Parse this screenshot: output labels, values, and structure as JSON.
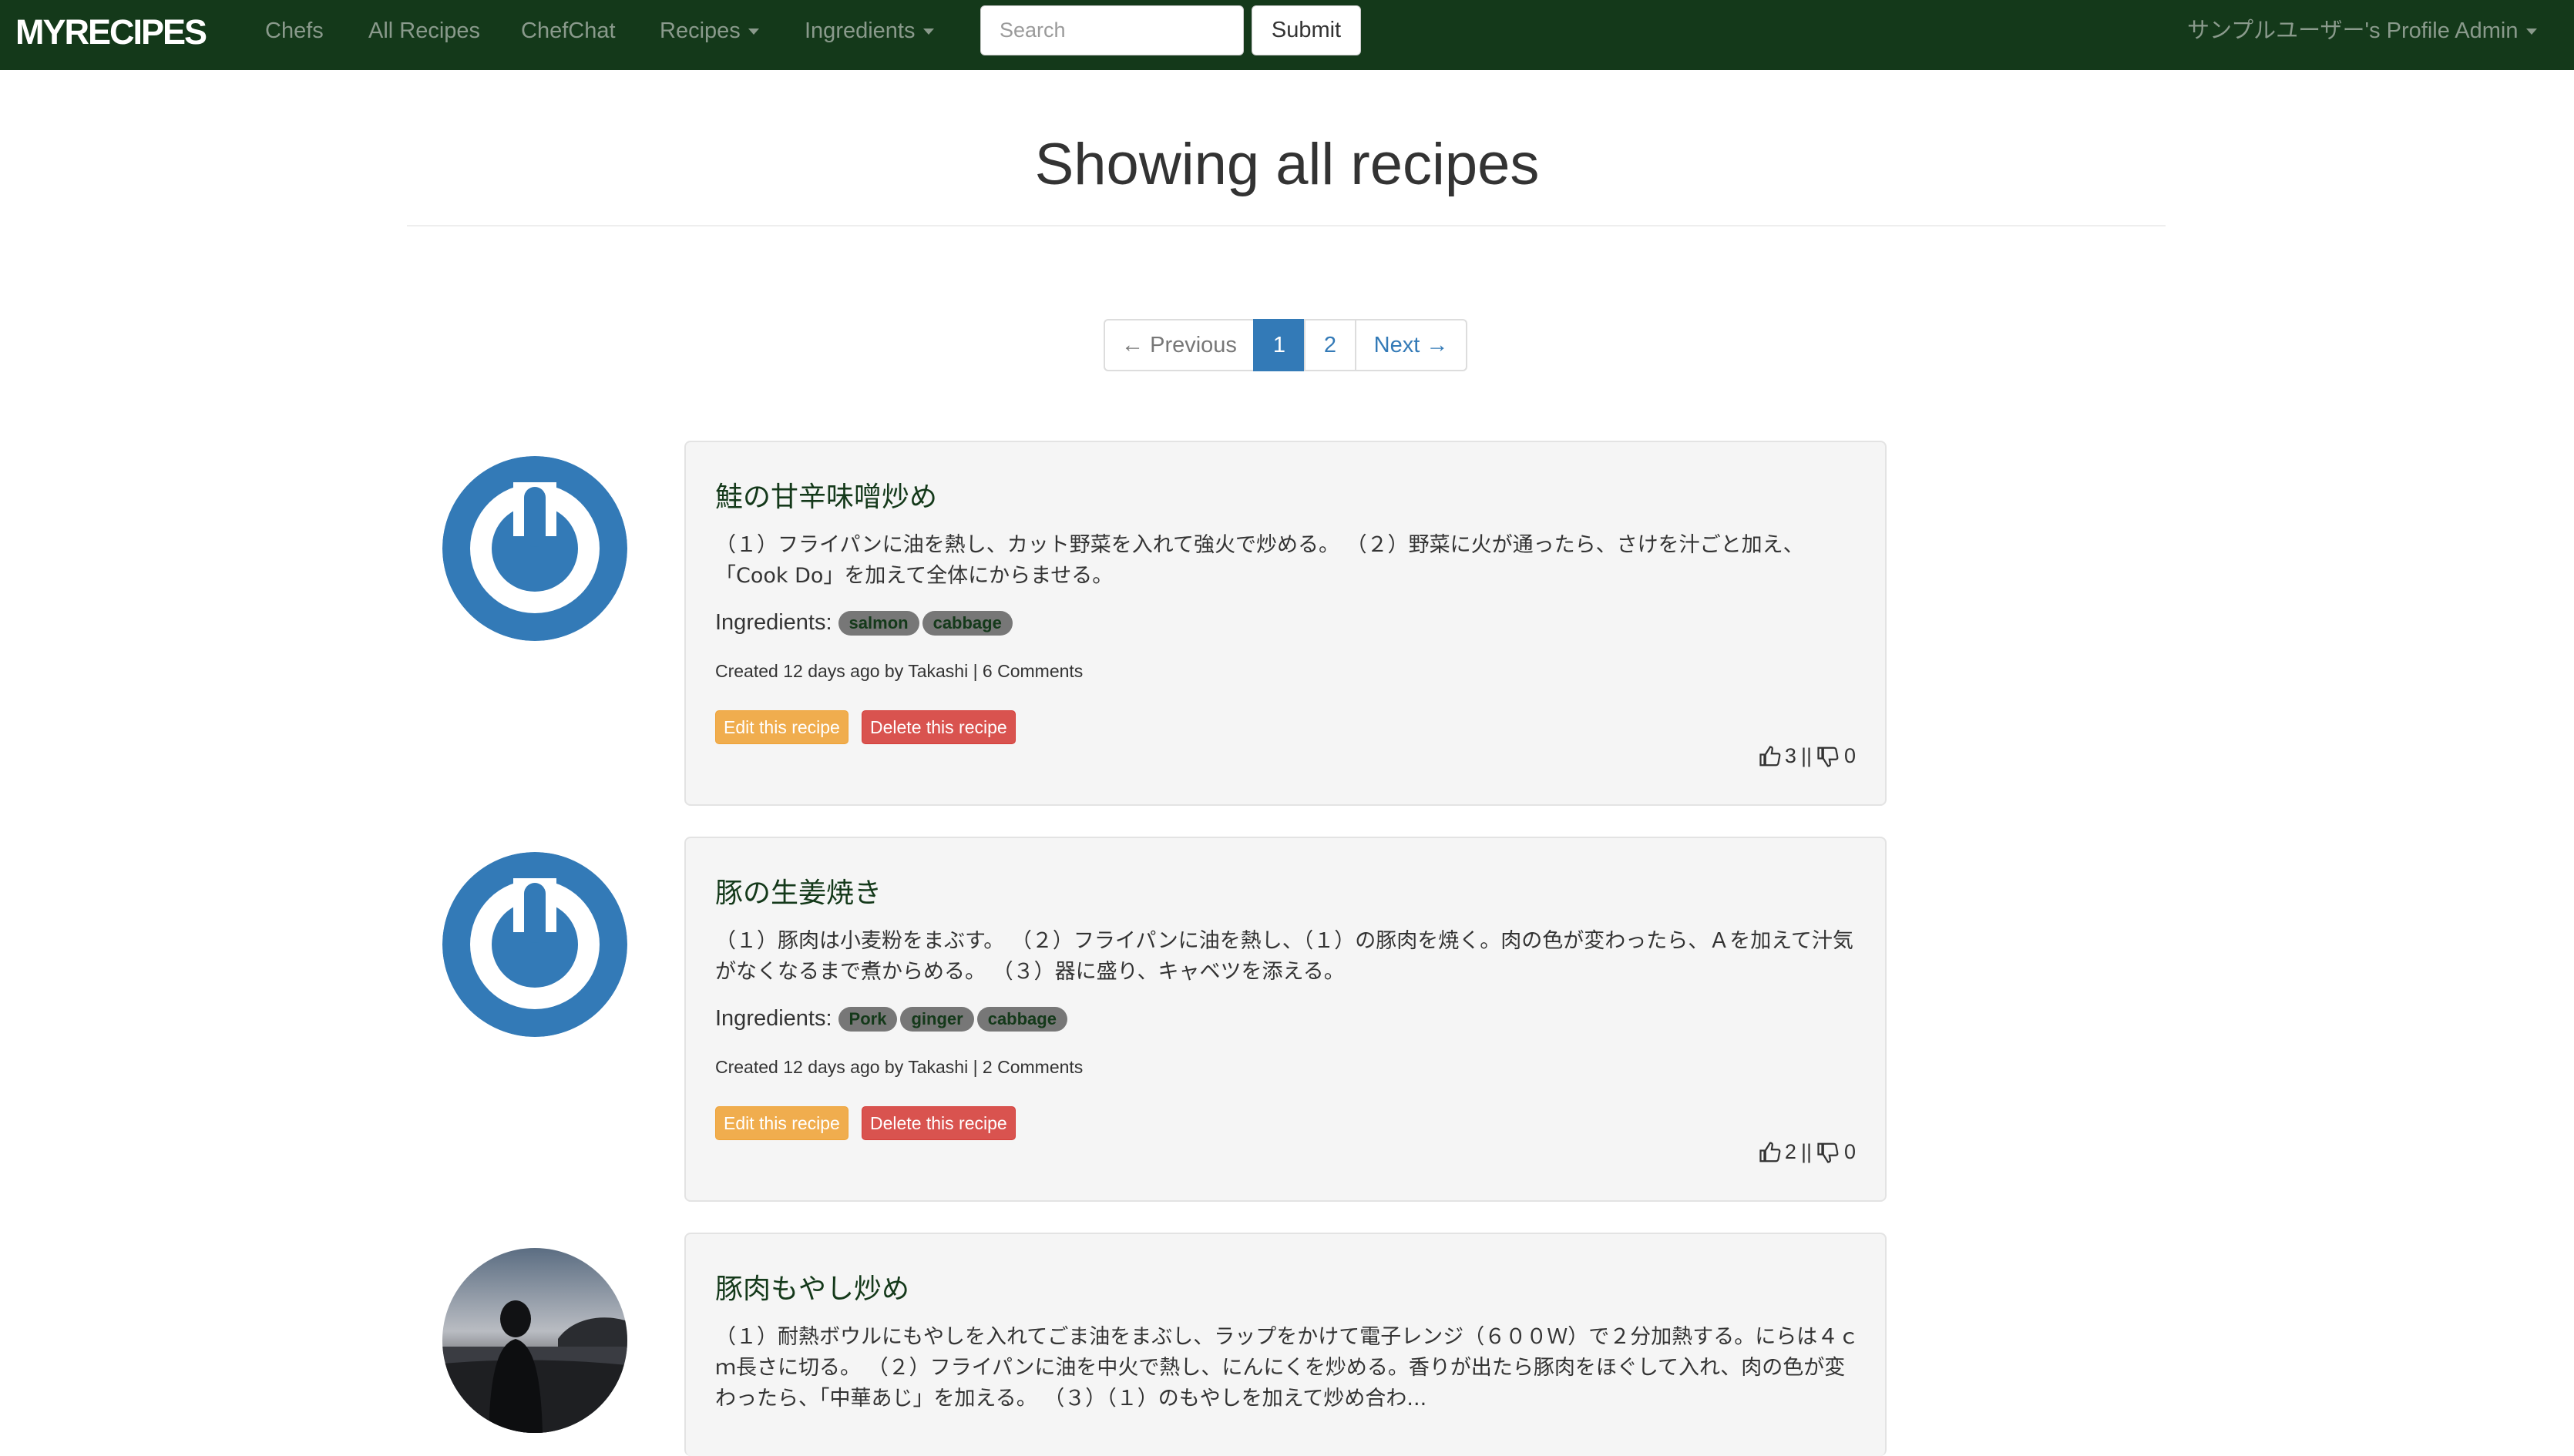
{
  "nav": {
    "brand": "MYRECIPES",
    "links": [
      "Chefs",
      "All Recipes",
      "ChefChat",
      "Recipes",
      "Ingredients"
    ],
    "search_placeholder": "Search",
    "submit_label": "Submit",
    "profile_label": "サンプルユーザー's Profile Admin"
  },
  "page": {
    "title": "Showing all recipes"
  },
  "pagination": {
    "previous": "← Previous",
    "pages": [
      "1",
      "2"
    ],
    "current": "1",
    "next": "Next →"
  },
  "recipes": [
    {
      "title": "鮭の甘辛味噌炒め",
      "description": "（１）フライパンに油を熱し、カット野菜を入れて強火で炒める。 （２）野菜に火が通ったら、さけを汁ごと加え、「Cook Do」を加えて全体にからませる。",
      "ingredients_label": "Ingredients:",
      "ingredients": [
        "salmon",
        "cabbage"
      ],
      "meta": "Created 12 days ago by Takashi | 6 Comments",
      "edit_label": "Edit this recipe",
      "delete_label": "Delete this recipe",
      "likes": "3",
      "separator": "||",
      "dislikes": "0",
      "avatar": "power-icon-avatar"
    },
    {
      "title": "豚の生姜焼き",
      "description": "（１）豚肉は小麦粉をまぶす。 （２）フライパンに油を熱し、（１）の豚肉を焼く。肉の色が変わったら、Ａを加えて汁気がなくなるまで煮からめる。 （３）器に盛り、キャベツを添える。",
      "ingredients_label": "Ingredients:",
      "ingredients": [
        "Pork",
        "ginger",
        "cabbage"
      ],
      "meta": "Created 12 days ago by Takashi | 2 Comments",
      "edit_label": "Edit this recipe",
      "delete_label": "Delete this recipe",
      "likes": "2",
      "separator": "||",
      "dislikes": "0",
      "avatar": "power-icon-avatar"
    },
    {
      "title": "豚肉もやし炒め",
      "description": "（１）耐熱ボウルにもやしを入れてごま油をまぶし、ラップをかけて電子レンジ（６００Ｗ）で２分加熱する。にらは４ｃｍ長さに切る。 （２）フライパンに油を中火で熱し、にんにくを炒める。香りが出たら豚肉をほぐして入れ、肉の色が変わったら、「中華あじ」を加える。 （３）（１）のもやしを加えて炒め合わ...",
      "avatar": "photo-avatar"
    }
  ],
  "colors": {
    "navbar": "#14391a",
    "accent": "#337ab7",
    "edit": "#f0ad4e",
    "delete": "#d9534f",
    "badge": "#777777"
  }
}
